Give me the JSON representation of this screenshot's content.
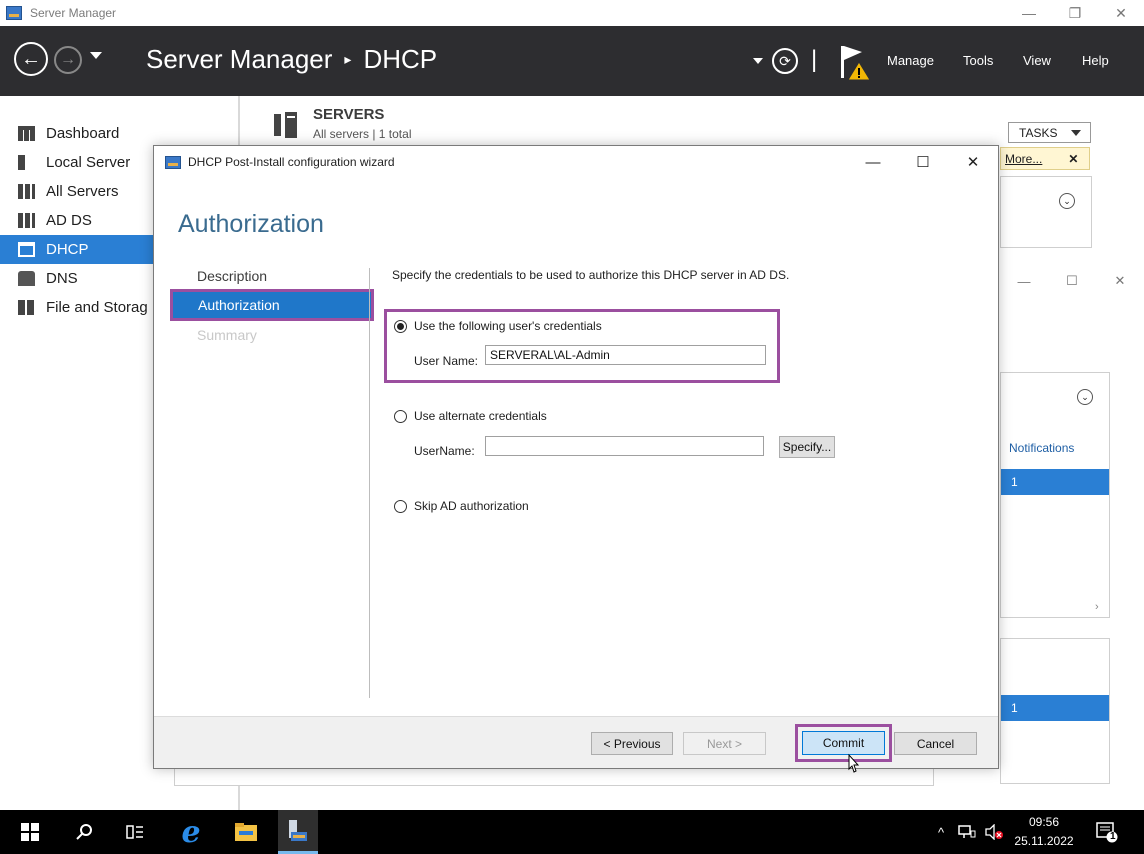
{
  "sm_window": {
    "title": "Server Manager",
    "controls": {
      "minimize": "—",
      "restore": "❐",
      "close": "✕"
    }
  },
  "header": {
    "app_name": "Server Manager",
    "separator": "▸",
    "current_page": "DHCP",
    "menus": [
      "Manage",
      "Tools",
      "View",
      "Help"
    ]
  },
  "sidebar": {
    "items": [
      {
        "label": "Dashboard",
        "icon": "dashboard-icon"
      },
      {
        "label": "Local Server",
        "icon": "server-icon"
      },
      {
        "label": "All Servers",
        "icon": "servers-icon"
      },
      {
        "label": "AD DS",
        "icon": "adds-icon"
      },
      {
        "label": "DHCP",
        "icon": "dhcp-icon",
        "active": true
      },
      {
        "label": "DNS",
        "icon": "dns-icon"
      },
      {
        "label": "File and Storag",
        "icon": "file-storage-icon"
      }
    ]
  },
  "servers_panel": {
    "title": "SERVERS",
    "subtitle": "All servers | 1 total",
    "tasks_label": "TASKS",
    "more_link": "More...",
    "more_close": "✕",
    "notifications_header": "Notifications",
    "notifications_value": "1",
    "row_value_2": "1"
  },
  "wizard": {
    "title": "DHCP Post-Install configuration wizard",
    "heading": "Authorization",
    "nav": [
      {
        "label": "Description",
        "state": "normal"
      },
      {
        "label": "Authorization",
        "state": "active"
      },
      {
        "label": "Summary",
        "state": "disabled"
      }
    ],
    "description": "Specify the credentials to be used to authorize this DHCP server in AD DS.",
    "option_user_credentials": "Use the following user's credentials",
    "user_name_label": "User Name:",
    "user_name_value": "SERVERAL\\AL-Admin",
    "option_alternate": "Use alternate credentials",
    "alt_user_name_label": "UserName:",
    "alt_user_name_value": "",
    "specify_button": "Specify...",
    "option_skip": "Skip AD authorization",
    "buttons": {
      "previous": "< Previous",
      "next": "Next >",
      "commit": "Commit",
      "cancel": "Cancel"
    }
  },
  "taskbar": {
    "time": "09:56",
    "date": "25.11.2022",
    "notification_count": "1"
  },
  "colors": {
    "header_bg": "#2d2d30",
    "accent_blue": "#2a7fd4",
    "highlight_purple": "#9b4f9f",
    "heading_blue": "#3a6b8f"
  }
}
